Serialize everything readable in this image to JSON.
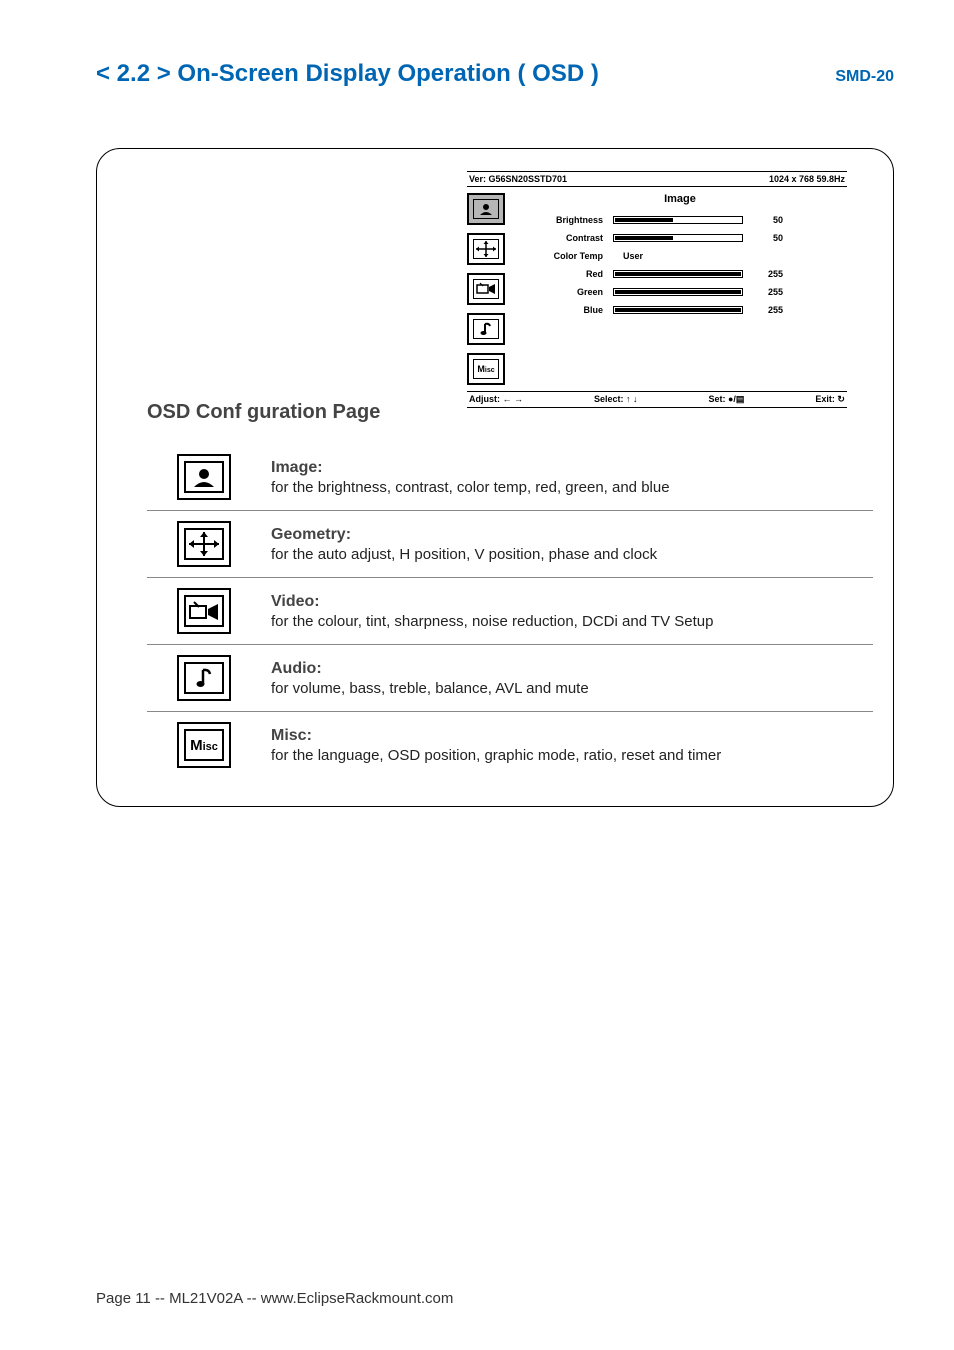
{
  "header": {
    "title": "< 2.2 > On-Screen Display Operation ( OSD )",
    "model": "SMD-20"
  },
  "osd": {
    "version_label": "Ver: G56SN20SSTD701",
    "resolution_label": "1024 x 768  59.8Hz",
    "category": "Image",
    "rows": {
      "brightness": {
        "label": "Brightness",
        "value": "50",
        "fill": 45
      },
      "contrast": {
        "label": "Contrast",
        "value": "50",
        "fill": 45
      },
      "colortemp": {
        "label": "Color Temp",
        "text": "User"
      },
      "red": {
        "label": "Red",
        "value": "255",
        "fill": 100
      },
      "green": {
        "label": "Green",
        "value": "255",
        "fill": 100
      },
      "blue": {
        "label": "Blue",
        "value": "255",
        "fill": 100
      }
    },
    "footer": {
      "adjust": "Adjust: ← →",
      "select": "Select: ↑ ↓",
      "set": "Set: ●/▤",
      "exit": "Exit: ↻"
    }
  },
  "subtitle": "OSD Conf guration Page",
  "defs": [
    {
      "title": "Image:",
      "desc": "for the brightness, contrast, color temp, red, green, and blue"
    },
    {
      "title": "Geometry:",
      "desc": "for the auto adjust, H position, V position, phase and clock"
    },
    {
      "title": "Video:",
      "desc": "for the colour, tint, sharpness, noise reduction, DCDi and TV Setup"
    },
    {
      "title": "Audio:",
      "desc": "for volume, bass, treble, balance, AVL and mute"
    },
    {
      "title": "Misc:",
      "desc": "for the language, OSD position, graphic mode, ratio, reset and timer"
    }
  ],
  "footer_line": "Page 11 -- ML21V02A -- www.EclipseRackmount.com",
  "icons": {
    "misc_text": "Misc"
  }
}
